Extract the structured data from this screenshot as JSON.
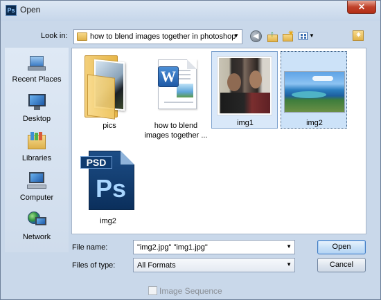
{
  "window": {
    "title": "Open",
    "app_icon": "Ps",
    "close_glyph": "✕"
  },
  "look_in": {
    "label": "Look in:",
    "value": "how to blend images together in photoshop"
  },
  "toolbar": {
    "back_glyph": "◀",
    "up_glyph": "↑",
    "new_folder_glyph": "✷",
    "fav_glyph": "✷"
  },
  "places": [
    {
      "label": "Recent Places",
      "icon": "recent-places-icon"
    },
    {
      "label": "Desktop",
      "icon": "desktop-icon"
    },
    {
      "label": "Libraries",
      "icon": "libraries-icon"
    },
    {
      "label": "Computer",
      "icon": "computer-icon"
    },
    {
      "label": "Network",
      "icon": "network-icon"
    }
  ],
  "files": [
    {
      "label": "pics",
      "type": "folder",
      "selected": false
    },
    {
      "label_line1": "how to blend",
      "label_line2": "images together ...",
      "type": "word-document",
      "badge": "W",
      "selected": false
    },
    {
      "label": "img1",
      "type": "image",
      "selected": true
    },
    {
      "label": "img2",
      "type": "image",
      "selected": true
    },
    {
      "label": "img2",
      "type": "psd",
      "badge": "PSD",
      "glyph": "Ps",
      "selected": false
    }
  ],
  "file_name": {
    "label": "File name:",
    "value": "\"img2.jpg\" \"img1.jpg\""
  },
  "file_type": {
    "label": "Files of type:",
    "value": "All Formats"
  },
  "buttons": {
    "open": "Open",
    "cancel": "Cancel"
  },
  "image_sequence": {
    "label": "Image Sequence",
    "checked": false,
    "enabled": false
  }
}
